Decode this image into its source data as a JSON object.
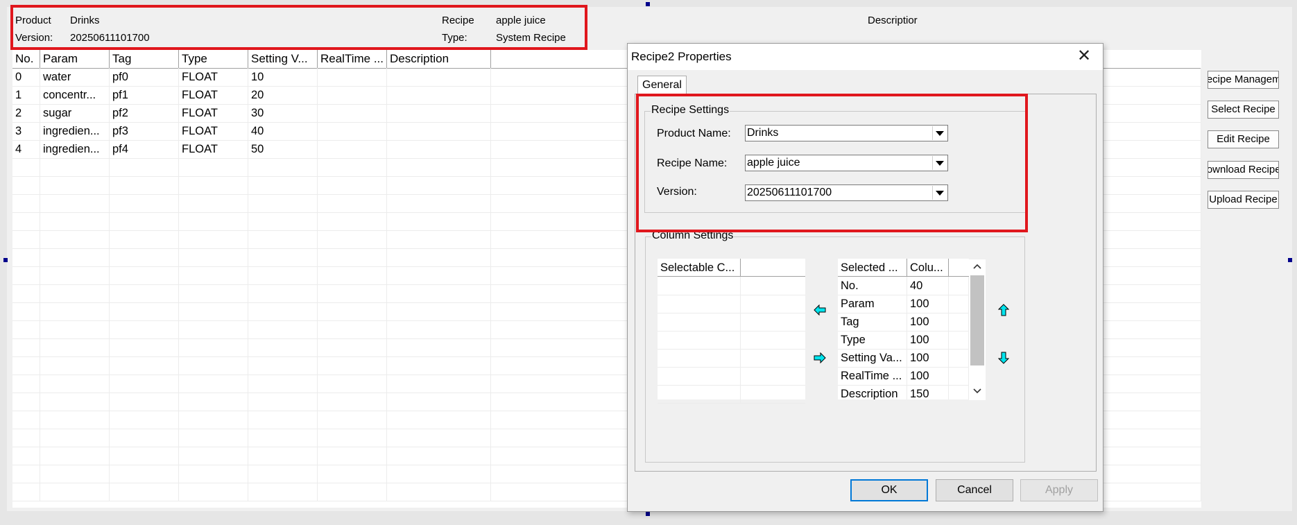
{
  "header": {
    "product_label": "Product",
    "product_value": "Drinks",
    "version_label": "Version:",
    "version_value": "20250611101700",
    "recipe_label": "Recipe",
    "recipe_value": "apple juice",
    "type_label": "Type:",
    "type_value": "System Recipe",
    "description_label": "Descriptior"
  },
  "grid": {
    "columns": [
      "No.",
      "Param",
      "Tag",
      "Type",
      "Setting V...",
      "RealTime ...",
      "Description"
    ],
    "rows": [
      [
        "0",
        "water",
        "pf0",
        "FLOAT",
        "10",
        "",
        ""
      ],
      [
        "1",
        "concentr...",
        "pf1",
        "FLOAT",
        "20",
        "",
        ""
      ],
      [
        "2",
        "sugar",
        "pf2",
        "FLOAT",
        "30",
        "",
        ""
      ],
      [
        "3",
        "ingredien...",
        "pf3",
        "FLOAT",
        "40",
        "",
        ""
      ],
      [
        "4",
        "ingredien...",
        "pf4",
        "FLOAT",
        "50",
        "",
        ""
      ]
    ]
  },
  "right_buttons": [
    "Recipe Management",
    "Select Recipe",
    "Edit Recipe",
    "Download Recipe",
    "Upload Recipe"
  ],
  "dialog": {
    "title": "Recipe2 Properties",
    "tab": "General",
    "recipe_settings": {
      "group_label": "Recipe Settings",
      "product_name_label": "Product Name:",
      "product_name_value": "Drinks",
      "recipe_name_label": "Recipe Name:",
      "recipe_name_value": "apple juice",
      "version_label": "Version:",
      "version_value": "20250611101700"
    },
    "column_settings": {
      "group_label": "Column Settings",
      "selectable_header": "Selectable C...",
      "selected_headers": [
        "Selected ...",
        "Colu..."
      ],
      "selected_rows": [
        [
          "No.",
          "40"
        ],
        [
          "Param",
          "100"
        ],
        [
          "Tag",
          "100"
        ],
        [
          "Type",
          "100"
        ],
        [
          "Setting Va...",
          "100"
        ],
        [
          "RealTime ...",
          "100"
        ],
        [
          "Description",
          "150"
        ]
      ]
    },
    "buttons": {
      "ok": "OK",
      "cancel": "Cancel",
      "apply": "Apply"
    }
  },
  "colors": {
    "highlight": "#e0171d",
    "arrow": "#00e5ee",
    "accent": "#0078d7"
  }
}
